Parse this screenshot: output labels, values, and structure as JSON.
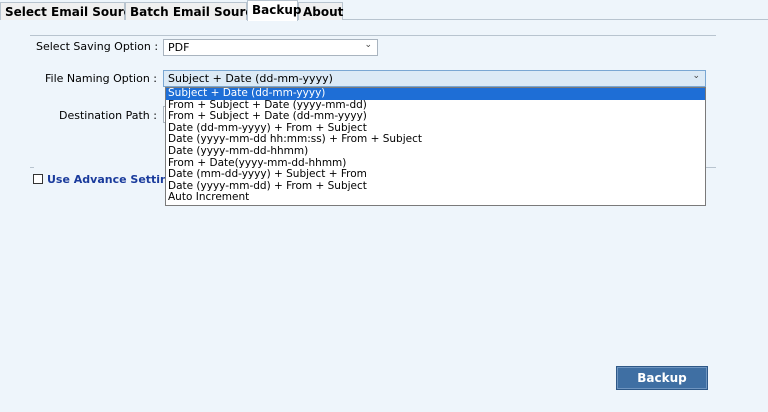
{
  "tabs": [
    {
      "label": "Select Email Source",
      "active": false
    },
    {
      "label": "Batch Email Source",
      "active": false
    },
    {
      "label": "Backup",
      "active": true
    },
    {
      "label": "About",
      "active": false
    }
  ],
  "form": {
    "saving_option_label": "Select Saving Option :",
    "saving_option_value": "PDF",
    "naming_option_label": "File Naming Option :",
    "naming_option_value": "Subject + Date (dd-mm-yyyy)",
    "destination_label": "Destination Path :",
    "destination_value": ""
  },
  "naming_options": [
    "Subject + Date (dd-mm-yyyy)",
    "From + Subject + Date (yyyy-mm-dd)",
    "From + Subject + Date (dd-mm-yyyy)",
    "Date (dd-mm-yyyy) + From + Subject",
    "Date (yyyy-mm-dd hh:mm:ss) + From + Subject",
    "Date (yyyy-mm-dd-hhmm)",
    "From + Date(yyyy-mm-dd-hhmm)",
    "Date (mm-dd-yyyy) + Subject + From",
    "Date (yyyy-mm-dd) + From + Subject",
    "Auto Increment"
  ],
  "selected_naming_option": "Subject + Date (dd-mm-yyyy)",
  "advance_settings": {
    "label": "Use Advance Settings",
    "checked": false
  },
  "backup_button": "Backup",
  "icons": {
    "dropdown_arrow": "chevron-down-icon"
  },
  "colors": {
    "background": "#eef5fb",
    "selection": "#1e6ed6",
    "button": "#3f6fa3",
    "link_label": "#1a3b9c"
  }
}
